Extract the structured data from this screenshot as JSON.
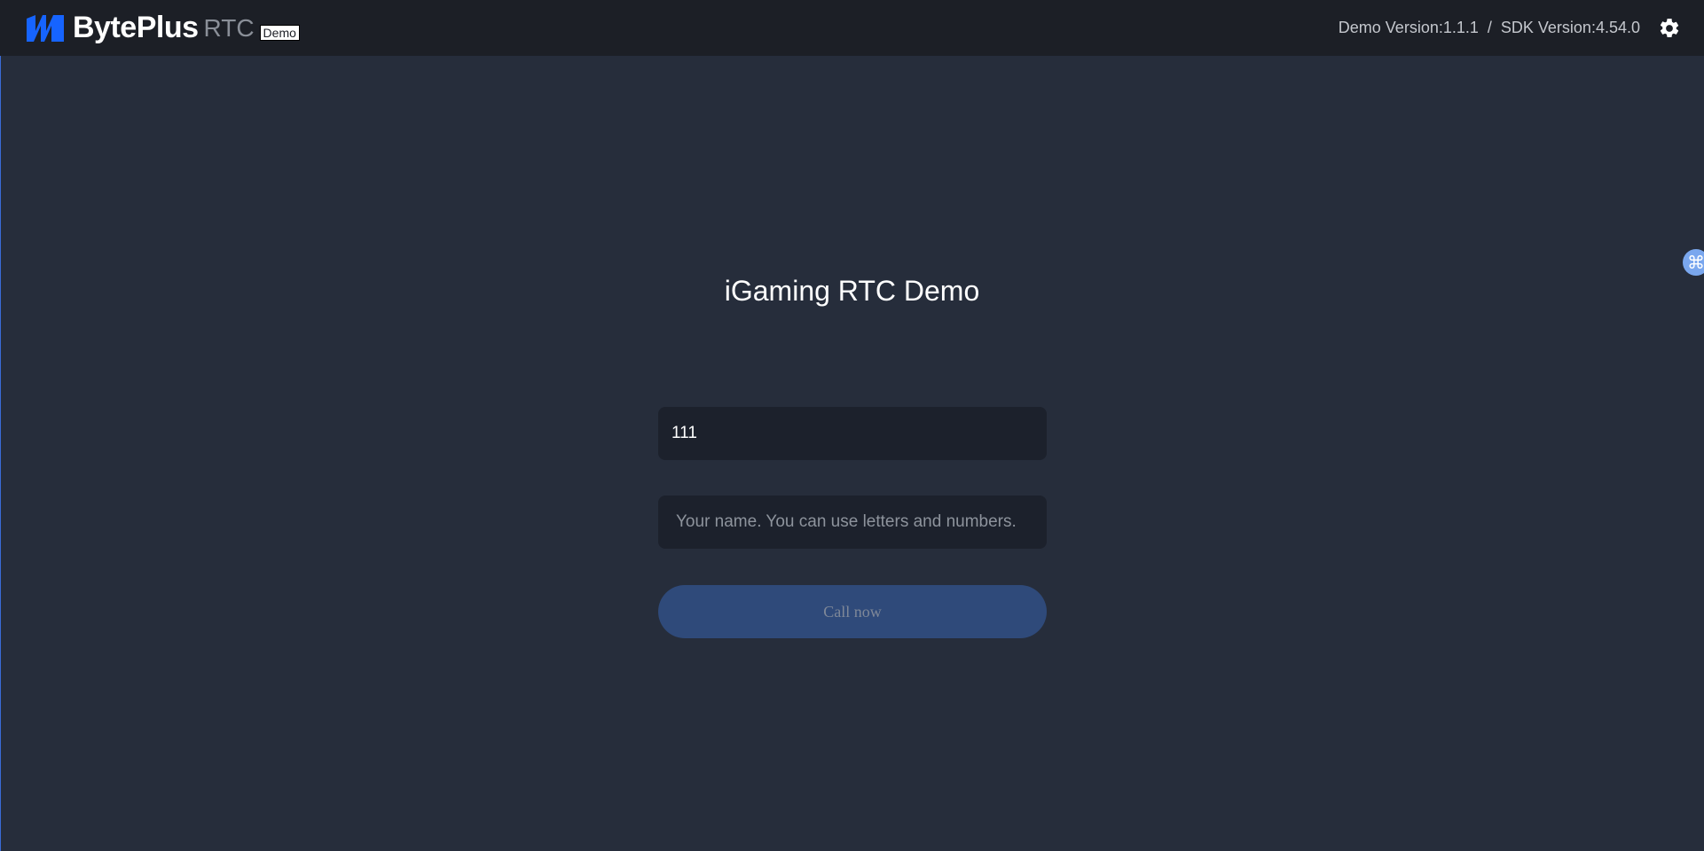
{
  "header": {
    "brand_name": "BytePlus",
    "brand_product": "RTC",
    "brand_badge": "Demo",
    "demo_version": "Demo Version:1.1.1",
    "separator": "/",
    "sdk_version": "SDK Version:4.54.0",
    "settings_icon": "gear-icon"
  },
  "main": {
    "title": "iGaming RTC Demo",
    "room_input": {
      "value": "111",
      "placeholder": ""
    },
    "name_input": {
      "value": "",
      "placeholder": "Your name. You can use letters and numbers."
    },
    "call_button_label": "Call now"
  },
  "floating_button": {
    "glyph": "⌘",
    "icon": "command-icon"
  },
  "colors": {
    "background": "#262d3b",
    "header": "#1c1f26",
    "accent": "#1664ff",
    "button_disabled": "#2f4a7a",
    "input_bg": "#1c212c"
  }
}
